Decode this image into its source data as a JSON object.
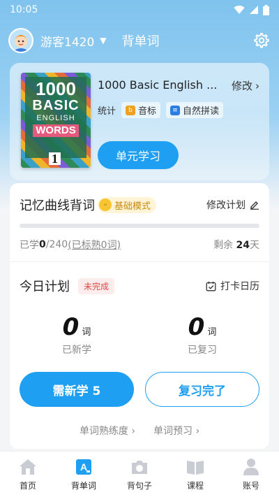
{
  "status_bar": {
    "time": "10:05"
  },
  "header": {
    "username": "游客1420",
    "title": "背单词"
  },
  "book": {
    "cover": {
      "num": "1000",
      "basic": "BASIC",
      "english": "ENGLISH",
      "words": "WORDS",
      "vol": "1"
    },
    "title": "1000 Basic English ...",
    "modify_label": "修改",
    "stats_label": "统计",
    "tag_phonetic": "音标",
    "tag_phonics": "自然拼读",
    "unit_button": "单元学习"
  },
  "memory": {
    "title": "记忆曲线背词",
    "mode": "基础模式",
    "edit_plan": "修改计划",
    "learned_prefix": "已学 ",
    "learned_count": "0",
    "learned_total": "/240 ",
    "learned_familiar": "(已标熟0词)",
    "remain_prefix": "剩余 ",
    "remain_days": "24",
    "remain_suffix": "天",
    "progress": 0
  },
  "today": {
    "title": "今日计划",
    "status": "未完成",
    "checkin": "打卡日历",
    "new_count": "0",
    "new_unit": "词",
    "new_label": "已新学",
    "review_count": "0",
    "review_unit": "词",
    "review_label": "已复习",
    "need_new_button": "需新学 5",
    "review_done_button": "复习完了",
    "link_proficiency": "单词熟练度",
    "link_preview": "单词预习"
  },
  "nav": {
    "items": [
      {
        "label": "首页",
        "icon": "home-icon"
      },
      {
        "label": "背单词",
        "icon": "word-card-icon"
      },
      {
        "label": "背句子",
        "icon": "camera-icon"
      },
      {
        "label": "课程",
        "icon": "book-icon"
      },
      {
        "label": "账号",
        "icon": "person-icon"
      }
    ],
    "active_index": 1
  },
  "colors": {
    "accent": "#1e9ff2",
    "warning": "#e04848",
    "badge": "#c88a10"
  }
}
